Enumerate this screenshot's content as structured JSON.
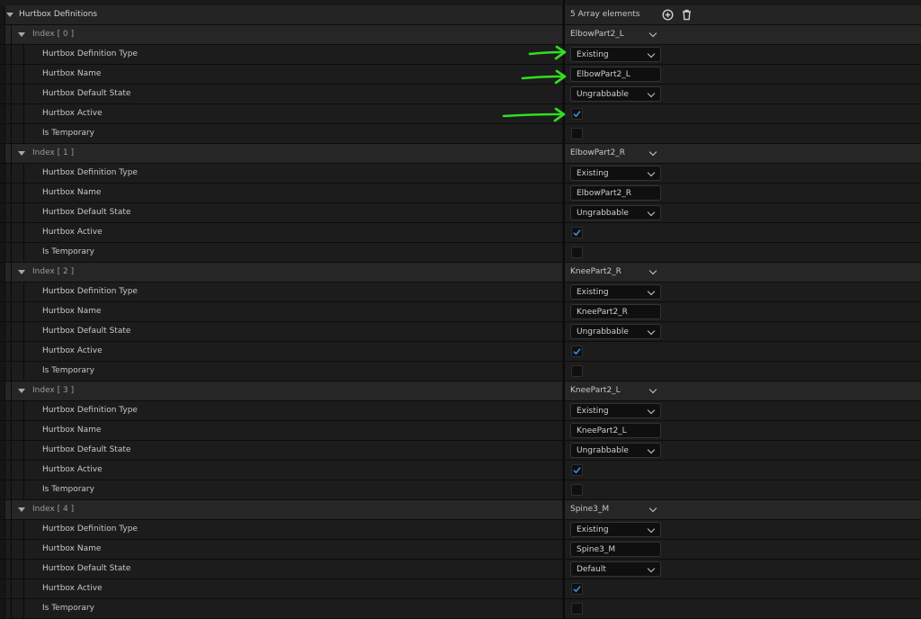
{
  "header": {
    "label": "Hurtbox Definitions",
    "value": "5 Array elements",
    "add_icon": "add-element-icon",
    "delete_icon": "trash-icon"
  },
  "field_labels": {
    "type": "Hurtbox Definition Type",
    "name": "Hurtbox Name",
    "state": "Hurtbox Default State",
    "active": "Hurtbox Active",
    "temporary": "Is Temporary"
  },
  "items": [
    {
      "index_label": "Index [ 0 ]",
      "summary": "ElbowPart2_L",
      "type": "Existing",
      "name": "ElbowPart2_L",
      "state": "Ungrabbable",
      "active": true,
      "temporary": false
    },
    {
      "index_label": "Index [ 1 ]",
      "summary": "ElbowPart2_R",
      "type": "Existing",
      "name": "ElbowPart2_R",
      "state": "Ungrabbable",
      "active": true,
      "temporary": false
    },
    {
      "index_label": "Index [ 2 ]",
      "summary": "KneePart2_R",
      "type": "Existing",
      "name": "KneePart2_R",
      "state": "Ungrabbable",
      "active": true,
      "temporary": false
    },
    {
      "index_label": "Index [ 3 ]",
      "summary": "KneePart2_L",
      "type": "Existing",
      "name": "KneePart2_L",
      "state": "Ungrabbable",
      "active": true,
      "temporary": false
    },
    {
      "index_label": "Index [ 4 ]",
      "summary": "Spine3_M",
      "type": "Existing",
      "name": "Spine3_M",
      "state": "Default",
      "active": true,
      "temporary": false
    }
  ],
  "colors": {
    "checkmark": "#3d8fe0",
    "annotation_arrow": "#33dd22"
  }
}
